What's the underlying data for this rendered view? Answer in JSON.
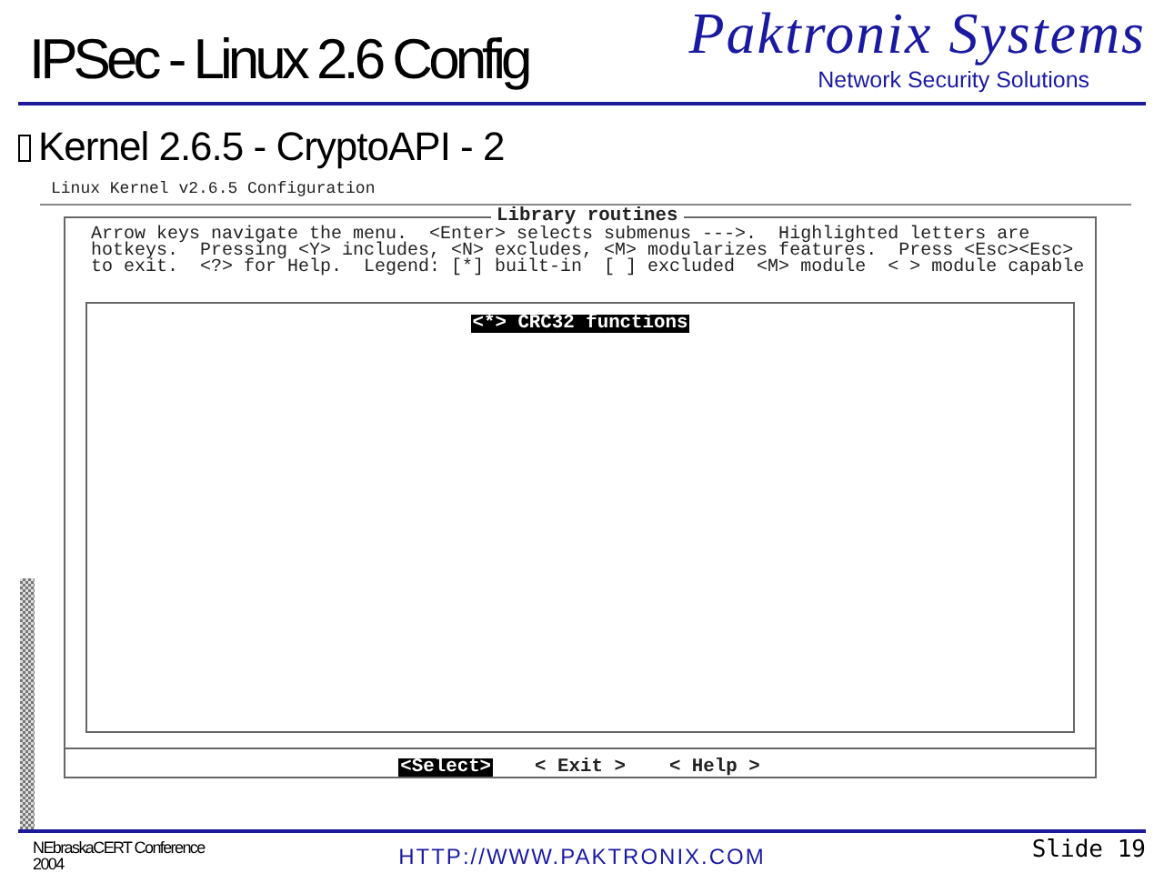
{
  "slide": {
    "title": "IPSec - Linux 2.6 Config",
    "logo": {
      "name": "Paktronix Systems",
      "tagline": "Network Security Solutions"
    },
    "bullet": "Kernel 2.6.5 - CryptoAPI - 2"
  },
  "terminal": {
    "header": "Linux Kernel v2.6.5 Configuration",
    "dialog_title": "Library routines",
    "help_lines": [
      "Arrow keys navigate the menu.  <Enter> selects submenus --->.  Highlighted letters are",
      "hotkeys.  Pressing <Y> includes, <N> excludes, <M> modularizes features.  Press <Esc><Esc>",
      "to exit.  <?> for Help.  Legend: [*] built-in  [ ] excluded  <M> module  < > module capable"
    ],
    "items": [
      {
        "text": "<*> CRC32 functions",
        "selected": true
      }
    ],
    "buttons": [
      {
        "label": "<Select>",
        "selected": true
      },
      {
        "label": "< Exit >",
        "selected": false
      },
      {
        "label": "< Help >",
        "selected": false
      }
    ]
  },
  "footer": {
    "conference": "NEbraskaCERT Conference",
    "year": "2004",
    "url": "HTTP://WWW.PAKTRONIX.COM",
    "slide_number": "Slide 19"
  }
}
